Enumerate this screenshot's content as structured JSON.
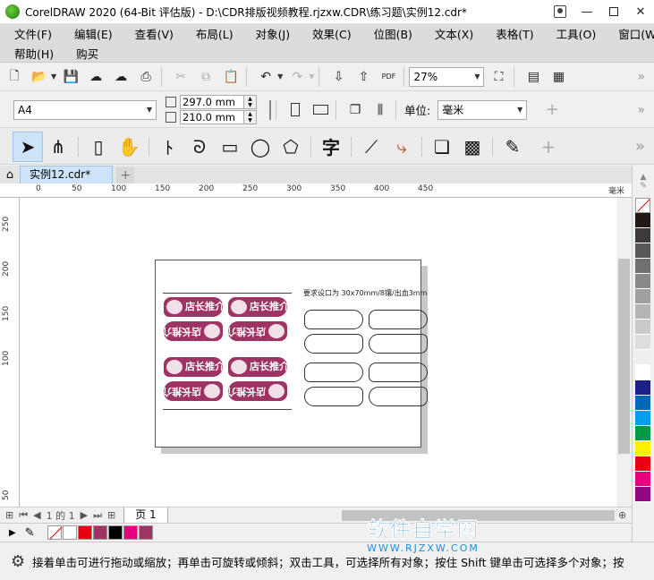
{
  "window": {
    "title": "CorelDRAW 2020 (64-Bit 评估版) - D:\\CDR排版视频教程.rjzxw.CDR\\练习题\\实例12.cdr*"
  },
  "menu": {
    "row1": [
      "文件(F)",
      "编辑(E)",
      "查看(V)",
      "布局(L)",
      "对象(J)",
      "效果(C)",
      "位图(B)",
      "文本(X)",
      "表格(T)",
      "工具(O)",
      "窗口(W)"
    ],
    "row2": [
      "帮助(H)",
      "购买"
    ]
  },
  "toolbar": {
    "zoom": "27%"
  },
  "property_bar": {
    "page_size": "A4",
    "width": "297.0 mm",
    "height": "210.0 mm",
    "units_label": "单位:",
    "units_value": "毫米"
  },
  "document_tab": {
    "label": "实例12.cdr*"
  },
  "ruler": {
    "h_labels": [
      "0",
      "50",
      "100",
      "150",
      "200",
      "250",
      "300",
      "350",
      "400",
      "450"
    ],
    "h_unit": "毫米",
    "v_labels": [
      "250",
      "200",
      "150",
      "100",
      "50"
    ]
  },
  "canvas": {
    "spec_note": "要求设口为 30x70mm/8镶/出血3mm",
    "card_text": "店长推介",
    "card_text_flipped": "店长推介"
  },
  "page_nav": {
    "info": "1 的 1",
    "page_tab": "页 1"
  },
  "palette": {
    "colors": [
      "#231815",
      "#3e3a39",
      "#595757",
      "#727171",
      "#898989",
      "#9fa0a0",
      "#b5b5b6",
      "#c9caca",
      "#dcdddd",
      "#efefef",
      "#ffffff",
      "#1d2088",
      "#0068b7",
      "#00a0e9",
      "#009944",
      "#fff100",
      "#e60012",
      "#e4007f",
      "#920783"
    ]
  },
  "doc_palette": {
    "colors": [
      "#ffffff",
      "#e60012",
      "#9e3463",
      "#000000",
      "#e4007f",
      "#9e3463"
    ]
  },
  "status": {
    "text": "接着单击可进行拖动或缩放；再单击可旋转或倾斜；双击工具，可选择所有对象；按住 Shift 键单击可选择多个对象；按"
  },
  "watermark": {
    "title": "软件自学网",
    "url": "WWW.RJZXW.COM"
  }
}
